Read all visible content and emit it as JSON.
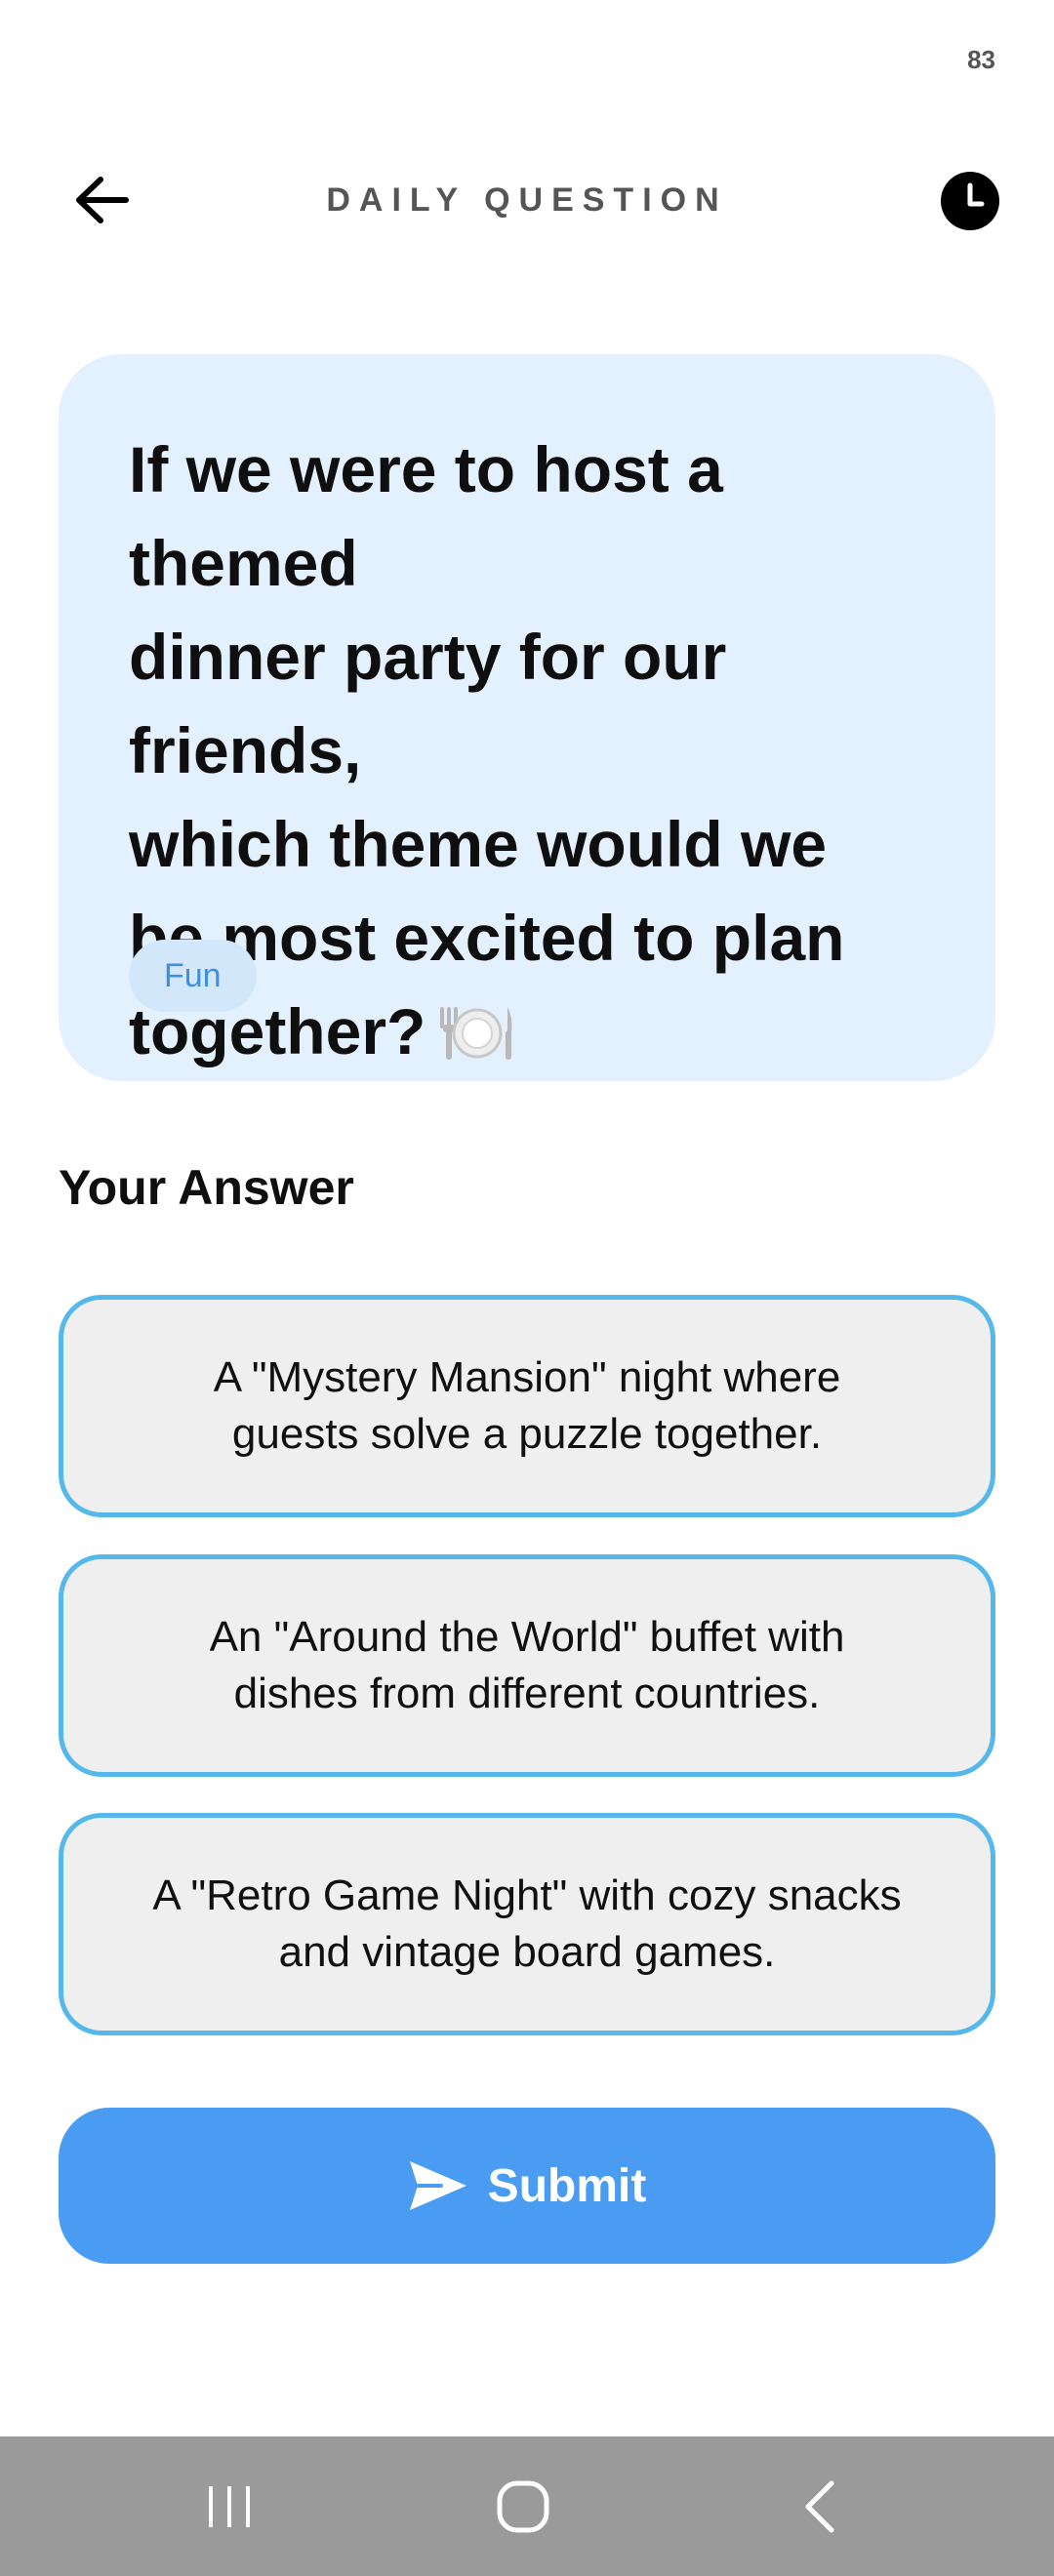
{
  "status_bar": {
    "battery": "83"
  },
  "header": {
    "title": "DAILY QUESTION",
    "back_icon": "arrow-left-icon",
    "history_icon": "clock-icon"
  },
  "question": {
    "text": "If we were to host a themed\ndinner party for our friends,\nwhich theme would we\nbe most excited to plan\ntogether?",
    "emoji_icon": "fork-plate-knife-icon",
    "tag": "Fun"
  },
  "answer": {
    "heading": "Your Answer",
    "options": [
      {
        "text": "A \"Mystery Mansion\" night where\nguests solve a puzzle together."
      },
      {
        "text": "An \"Around the World\" buffet with\ndishes from different countries."
      },
      {
        "text": "A \"Retro Game Night\" with cozy snacks\nand vintage board games."
      }
    ]
  },
  "submit": {
    "label": "Submit",
    "icon": "send-icon"
  },
  "colors": {
    "card_background": "#e3f0fd",
    "option_border": "#55b8ea",
    "submit_background": "#4a9cf2",
    "tag_text": "#3f8fdf"
  },
  "nav": {
    "recents_icon": "recents-icon",
    "home_icon": "home-icon",
    "back_icon": "nav-back-icon"
  }
}
